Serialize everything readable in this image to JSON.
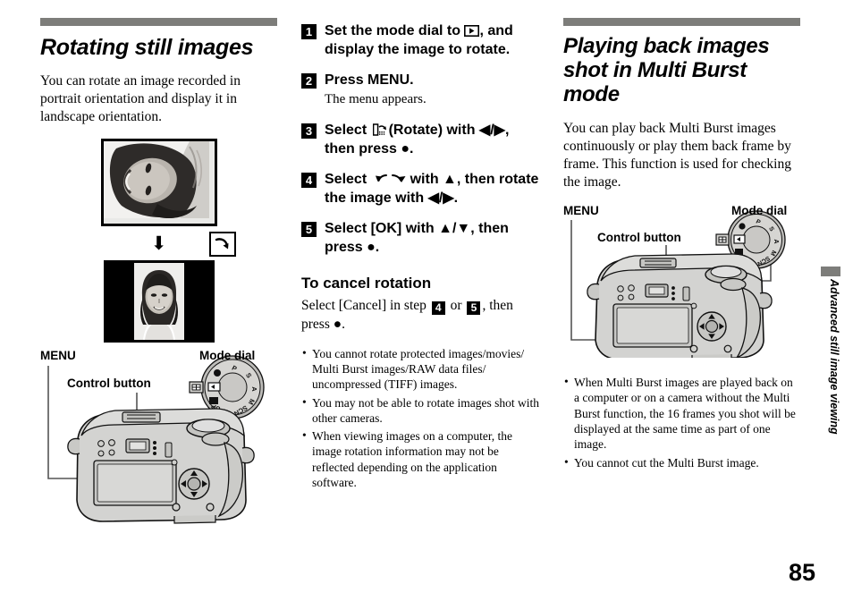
{
  "page": {
    "number": "85",
    "side_tab_label": "Advanced still image viewing"
  },
  "left_column": {
    "title": "Rotating still images",
    "intro": "You can rotate an image recorded in portrait orientation and display it in landscape orientation.",
    "figure": {
      "rotate_icon_name": "rotate-clockwise-icon",
      "down_arrow_name": "down-arrow-icon"
    },
    "camera_labels": {
      "menu": "MENU",
      "control_button": "Control button",
      "mode_dial": "Mode dial"
    }
  },
  "middle_column": {
    "steps": [
      {
        "number": "1",
        "text_before": "Set the mode dial to",
        "icon": "playback-mode-icon",
        "text_after": ", and display the image to rotate.",
        "sub": ""
      },
      {
        "number": "2",
        "text_before": "Press MENU.",
        "icon": "",
        "text_after": "",
        "sub": "The menu appears."
      },
      {
        "number": "3",
        "text_before": "Select",
        "icon": "rotate-menu-icon",
        "text_after": "(Rotate) with ◀/▶, then press ●.",
        "sub": ""
      },
      {
        "number": "4",
        "text_before": "Select",
        "icon": "rotate-arrows-icon",
        "text_after": "with ▲, then rotate the image with ◀/▶.",
        "sub": ""
      },
      {
        "number": "5",
        "text_before": "Select [OK] with ▲/▼, then press ●.",
        "icon": "",
        "text_after": "",
        "sub": ""
      }
    ],
    "cancel_heading": "To cancel rotation",
    "cancel_text_1": "Select [Cancel] in step",
    "cancel_step_a": "4",
    "cancel_text_2": "or",
    "cancel_step_b": "5",
    "cancel_text_3": ", then press ●.",
    "notes": [
      "You cannot rotate protected images/movies/ Multi Burst images/RAW data files/ uncompressed (TIFF) images.",
      "You may not be able to rotate images shot with other cameras.",
      "When viewing images on a computer, the image rotation information may not be reflected depending on the application software."
    ]
  },
  "right_column": {
    "title": "Playing back images shot in Multi Burst mode",
    "intro": "You can play back Multi Burst images continuously or play them back frame by frame. This function is used for checking the image.",
    "camera_labels": {
      "menu": "MENU",
      "control_button": "Control button",
      "mode_dial": "Mode dial"
    },
    "notes": [
      "When Multi Burst images are played back on a computer or on a camera without the Multi Burst function, the 16 frames you shot will be displayed at the same time as part of one image.",
      "You cannot cut the Multi Burst image."
    ]
  },
  "mode_dial": {
    "labels": [
      "P",
      "S",
      "A",
      "M",
      "SCN",
      "SET UP"
    ],
    "playback_marker": "▶"
  },
  "colors": {
    "rule_gray": "#7d7d7a",
    "camera_body": "#d3d3d1",
    "text": "#000000"
  }
}
